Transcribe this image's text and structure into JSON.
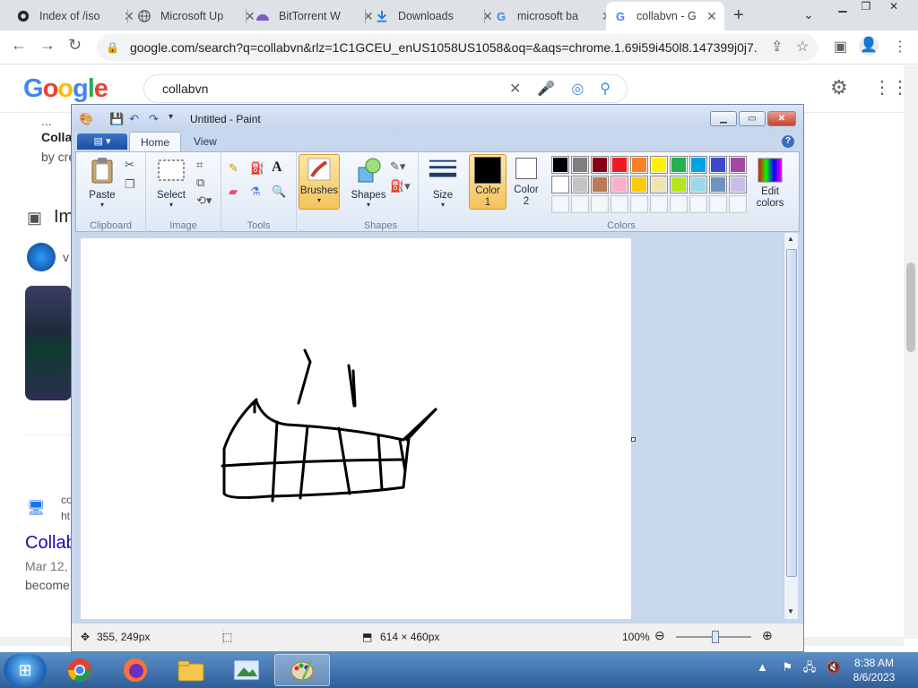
{
  "browser": {
    "tabs": [
      {
        "title": "Index of /iso",
        "icon": "github-icon"
      },
      {
        "title": "Microsoft Up",
        "icon": "globe-icon"
      },
      {
        "title": "BitTorrent W",
        "icon": "bittorrent-icon"
      },
      {
        "title": "Downloads",
        "icon": "download-icon"
      },
      {
        "title": "microsoft ba",
        "icon": "google-icon"
      },
      {
        "title": "collabvn - G",
        "icon": "google-icon"
      }
    ],
    "active_tab": 5,
    "url": "google.com/search?q=collabvn&rlz=1C1GCEU_enUS1058US1058&oq=&aqs=chrome.1.69i59i450l8.147399j0j7..."
  },
  "google": {
    "logo": "Google",
    "query": "collabvn",
    "snippets": {
      "ellipsis": "...",
      "colla": "Colla",
      "bycr": "by cre",
      "images": "Im",
      "v": "v",
      "co": "co",
      "ht": "ht",
      "result_title": "Collab",
      "date": "Mar 12,",
      "become": "become"
    }
  },
  "paint": {
    "title": "Untitled - Paint",
    "tabs": [
      "Home",
      "View"
    ],
    "groups": {
      "clipboard": "Clipboard",
      "image": "Image",
      "tools": "Tools",
      "shapes": "Shapes",
      "colors": "Colors"
    },
    "buttons": {
      "paste": "Paste",
      "select": "Select",
      "brushes": "Brushes",
      "shapes": "Shapes",
      "size": "Size",
      "color1": "Color 1",
      "color2": "Color 2",
      "edit_colors": "Edit colors"
    },
    "palette_row1": [
      "#000000",
      "#7f7f7f",
      "#880015",
      "#ed1c24",
      "#ff7f27",
      "#fff200",
      "#22b14c",
      "#00a2e8",
      "#3f48cc",
      "#a349a4"
    ],
    "palette_row2": [
      "#ffffff",
      "#c3c3c3",
      "#b97a57",
      "#ffaec9",
      "#ffc90e",
      "#efe4b0",
      "#b5e61d",
      "#99d9ea",
      "#7092be",
      "#c8bfe7"
    ],
    "color1": "#000000",
    "color2": "#ffffff",
    "status": {
      "cursor": "355, 249px",
      "size": "614 × 460px",
      "zoom": "100%"
    }
  },
  "taskbar": {
    "apps": [
      "chrome-icon",
      "firefox-icon",
      "explorer-icon",
      "picture-viewer-icon",
      "paint-icon"
    ],
    "time": "8:38 AM",
    "date": "8/6/2023"
  }
}
